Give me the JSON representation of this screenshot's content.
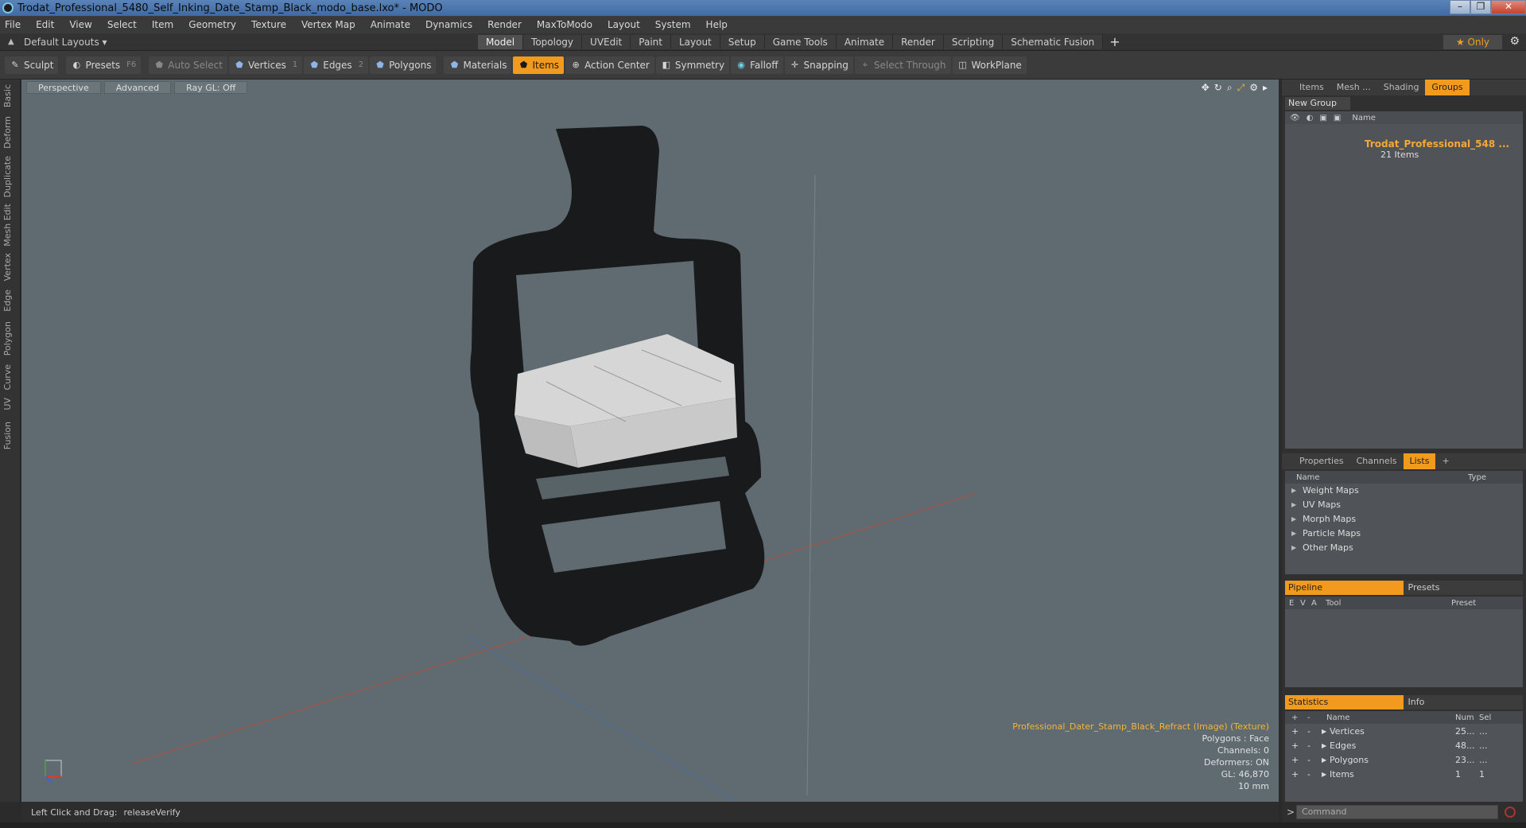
{
  "window": {
    "title": "Trodat_Professional_5480_Self_Inking_Date_Stamp_Black_modo_base.lxo* - MODO",
    "controls": [
      "–",
      "❐",
      "✕"
    ]
  },
  "menu": [
    "File",
    "Edit",
    "View",
    "Select",
    "Item",
    "Geometry",
    "Texture",
    "Vertex Map",
    "Animate",
    "Dynamics",
    "Render",
    "MaxToModo",
    "Layout",
    "System",
    "Help"
  ],
  "layoutbar": {
    "layouts_label": "Default Layouts ▾",
    "tabs": [
      "Model",
      "Topology",
      "UVEdit",
      "Paint",
      "Layout",
      "Setup",
      "Game Tools",
      "Animate",
      "Render",
      "Scripting",
      "Schematic Fusion"
    ],
    "active_tab": "Model",
    "add": "+",
    "only_label": "★  Only"
  },
  "toolbar": {
    "sculpt": "Sculpt",
    "presets": "Presets",
    "presets_key": "F6",
    "auto_select": "Auto Select",
    "vertices": "Vertices",
    "vertices_num": "1",
    "edges": "Edges",
    "edges_num": "2",
    "polygons": "Polygons",
    "materials": "Materials",
    "items": "Items",
    "action_center": "Action Center",
    "symmetry": "Symmetry",
    "falloff": "Falloff",
    "snapping": "Snapping",
    "select_through": "Select Through",
    "workplane": "WorkPlane"
  },
  "left_tabs": [
    "Basic",
    "Deform",
    "Duplicate",
    "Mesh Edit",
    "Vertex",
    "Edge",
    "Polygon",
    "Curve",
    "UV",
    "Fusion"
  ],
  "viewport": {
    "perspective": "Perspective",
    "advanced": "Advanced",
    "raygl": "Ray GL: Off",
    "info": {
      "texture": "Professional_Dater_Stamp_Black_Refract (Image) (Texture)",
      "polygons": "Polygons : Face",
      "channels": "Channels: 0",
      "deformers": "Deformers: ON",
      "gl": "GL: 46,870",
      "scale": "10 mm"
    }
  },
  "status": {
    "hint_label": "Left Click and Drag:",
    "hint_value": "releaseVerify"
  },
  "groups_panel": {
    "tabs": [
      "Items",
      "Mesh ...",
      "Shading",
      "Groups"
    ],
    "active": "Groups",
    "new_group": "New Group",
    "name_header": "Name",
    "group_name": "Trodat_Professional_548 ...",
    "group_count": "21 Items"
  },
  "lists_panel": {
    "tabs": [
      "Properties",
      "Channels",
      "Lists"
    ],
    "active": "Lists",
    "add": "+",
    "name_header": "Name",
    "type_header": "Type",
    "rows": [
      "Weight Maps",
      "UV Maps",
      "Morph Maps",
      "Particle Maps",
      "Other Maps"
    ]
  },
  "pipeline_panel": {
    "tab_on": "Pipeline",
    "tab_off": "Presets",
    "headers": [
      "E",
      "V",
      "A",
      "Tool",
      "Preset"
    ]
  },
  "stats_panel": {
    "tab_on": "Statistics",
    "tab_off": "Info",
    "headers": {
      "plus": "+",
      "minus": "-",
      "name": "Name",
      "num": "Num",
      "sel": "Sel"
    },
    "rows": [
      {
        "name": "Vertices",
        "num": "25...",
        "sel": "..."
      },
      {
        "name": "Edges",
        "num": "48...",
        "sel": "..."
      },
      {
        "name": "Polygons",
        "num": "23...",
        "sel": "..."
      },
      {
        "name": "Items",
        "num": "1",
        "sel": "1"
      }
    ]
  },
  "command": {
    "placeholder": "Command",
    "prompt": ">"
  }
}
